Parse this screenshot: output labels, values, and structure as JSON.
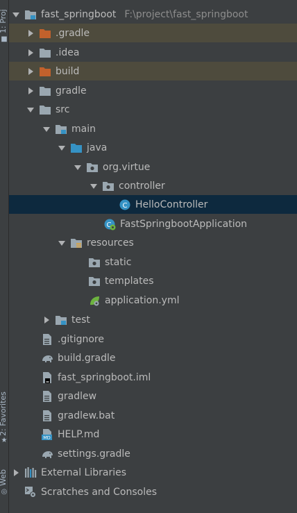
{
  "side_strip": {
    "top_label": "1: Proj",
    "favorites_label": "2: Favorites",
    "web_label": "Web"
  },
  "tree": {
    "root": {
      "label": "fast_springboot",
      "path": "F:\\project\\fast_springboot"
    },
    "items": [
      {
        "label": ".gradle"
      },
      {
        "label": ".idea"
      },
      {
        "label": "build"
      },
      {
        "label": "gradle"
      },
      {
        "label": "src"
      },
      {
        "label": "main"
      },
      {
        "label": "java"
      },
      {
        "label": "org.virtue"
      },
      {
        "label": "controller"
      },
      {
        "label": "HelloController"
      },
      {
        "label": "FastSpringbootApplication"
      },
      {
        "label": "resources"
      },
      {
        "label": "static"
      },
      {
        "label": "templates"
      },
      {
        "label": "application.yml"
      },
      {
        "label": "test"
      },
      {
        "label": ".gitignore"
      },
      {
        "label": "build.gradle"
      },
      {
        "label": "fast_springboot.iml"
      },
      {
        "label": "gradlew"
      },
      {
        "label": "gradlew.bat"
      },
      {
        "label": "HELP.md"
      },
      {
        "label": "settings.gradle"
      },
      {
        "label": "External Libraries"
      },
      {
        "label": "Scratches and Consoles"
      }
    ]
  },
  "colors": {
    "background": "#3c3f41",
    "excluded_row": "#4e4b3d",
    "selected_row": "#0d293e",
    "folder_gray": "#9aa7b0",
    "folder_orange": "#c2612c",
    "folder_blue": "#3592c4",
    "class_icon": "#3592c4",
    "spring_green": "#6db33f"
  }
}
